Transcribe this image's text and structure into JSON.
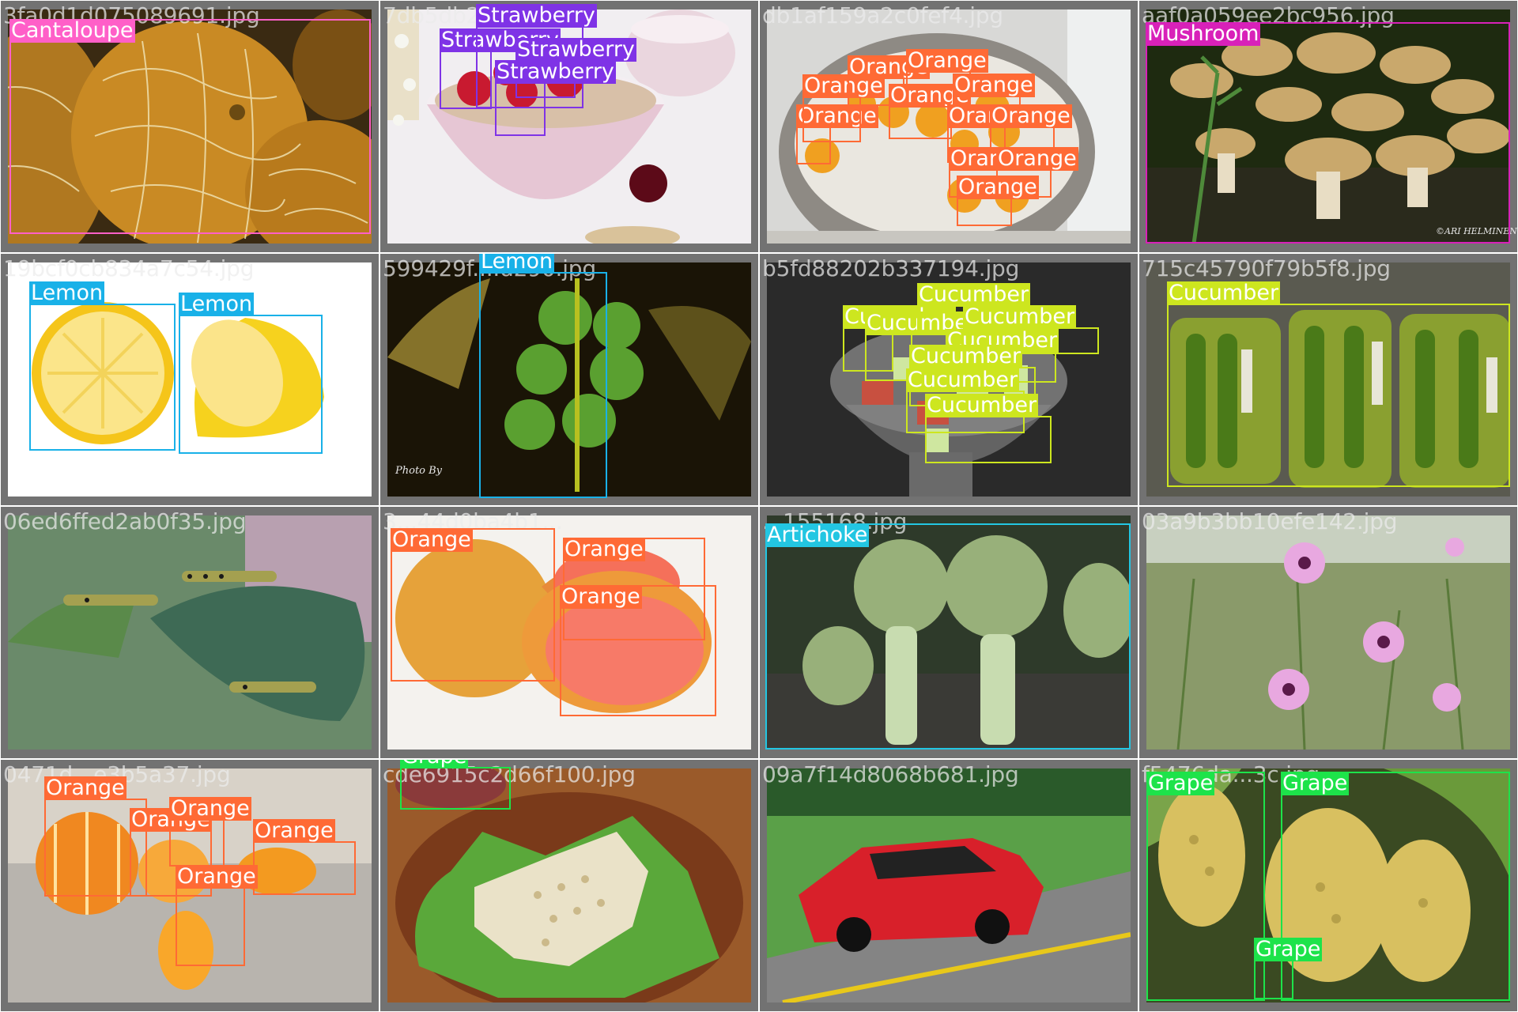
{
  "tiles": [
    {
      "filename": "3fa0d1d075089691.jpg",
      "labels": [
        "Cantaloupe"
      ],
      "colors": {
        "cantaloupe": "#ff5fc8"
      }
    },
    {
      "filename": "7db5db2d....jpg",
      "labels": [
        "Strawberry",
        "Strawberry",
        "Strawberry",
        "Strawberry"
      ]
    },
    {
      "filename": "db1af159a2c0fef4.jpg",
      "labels": [
        "Orange",
        "Orange",
        "Orange",
        "Orange",
        "Orange",
        "Orange",
        "Orange",
        "Orange",
        "Orange",
        "Orange",
        "Orange"
      ]
    },
    {
      "filename": "aaf0a059ee2bc956.jpg",
      "labels": [
        "Mushroom"
      ],
      "credit": "©ARI HELMINEN"
    },
    {
      "filename": "19bcf0cb834a7c54.jpg",
      "labels": [
        "Lemon",
        "Lemon"
      ]
    },
    {
      "filename": "599429f....d290.jpg",
      "labels": [
        "Lemon"
      ],
      "credit": "Photo By"
    },
    {
      "filename": "b5fd88202b337194.jpg",
      "labels": [
        "Cucumber",
        "Cucumber",
        "Cucumber",
        "Cucumber",
        "Cucumber",
        "Cucumber",
        "Cucumber",
        "Cucumber"
      ]
    },
    {
      "filename": "715c45790f79b5f8.jpg",
      "labels": [
        "Cucumber"
      ]
    },
    {
      "filename": "06ed6ffed2ab0f35.jpg",
      "labels": []
    },
    {
      "filename": "3...44d0ba4b1...",
      "labels": [
        "Orange",
        "Orange",
        "Orange"
      ]
    },
    {
      "filename": "...155168.jpg",
      "labels": [
        "Artichoke"
      ]
    },
    {
      "filename": "03a9b3bb10efe142.jpg",
      "labels": []
    },
    {
      "filename": "0471d...e3b5a37.jpg",
      "labels": [
        "Orange",
        "Orange",
        "Orange",
        "Orange",
        "Orange"
      ]
    },
    {
      "filename": "cde6915c2d66f100.jpg",
      "labels": [
        "Grape"
      ]
    },
    {
      "filename": "09a7f14d8068b681.jpg",
      "labels": []
    },
    {
      "filename": "f5476da...3c.jpg",
      "labels": [
        "Grape",
        "Grape",
        "Grape"
      ]
    }
  ],
  "colors": {
    "cantaloupe": "#ff5fc8",
    "strawberry": "#7f33e6",
    "orange": "#ff6a35",
    "mushroom": "#d821b9",
    "lemon": "#19b1e8",
    "cucumber": "#cde61f",
    "artichoke": "#23c6e2",
    "grape": "#1de34a"
  }
}
